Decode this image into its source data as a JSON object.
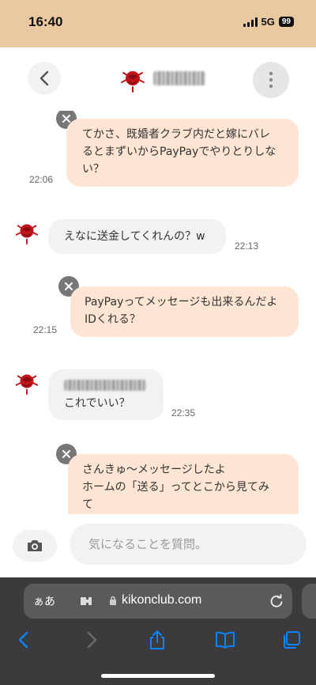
{
  "status_bar": {
    "time": "16:40",
    "network": "5G",
    "battery": "99"
  },
  "header": {
    "back_icon": "chevron-left-icon",
    "menu_icon": "more-vertical-icon",
    "avatar_icon": "rose-avatar-icon"
  },
  "messages": [
    {
      "direction": "out",
      "lines": [
        "てかさ、既婚者クラブ内だと嫁にバレ",
        "るとまずいからPayPayでやりとりしな",
        "い？"
      ],
      "time": "22:06"
    },
    {
      "direction": "in",
      "lines": [
        "えなに送金してくれんの？w"
      ],
      "time": "22:13"
    },
    {
      "direction": "out",
      "lines": [
        "PayPayってメッセージも出来るんだよ",
        "IDくれる？"
      ],
      "time": "22:15"
    },
    {
      "direction": "in",
      "lines": [
        "これでいい？"
      ],
      "time": "22:35"
    },
    {
      "direction": "out",
      "lines": [
        "さんきゅ〜メッセージしたよ",
        "ホームの「送る」ってとこから見てみ",
        "て"
      ]
    }
  ],
  "composer": {
    "placeholder": "気になることを質問。",
    "camera_icon": "camera-icon"
  },
  "browser": {
    "aa_label": "ぁあ",
    "url": "kikonclub.com"
  },
  "colors": {
    "status_bg": "#e9c99f",
    "out_bubble": "#fde4d3",
    "in_bubble": "#f2f2f2",
    "toolbar_blue": "#0a84ff"
  }
}
